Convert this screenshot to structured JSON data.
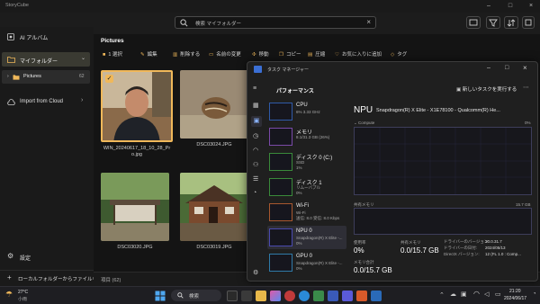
{
  "app": {
    "title": "StoryCube",
    "search_placeholder": "検索 マイフォルダー"
  },
  "sidebar": {
    "ai_album": "AI アルバム",
    "my_folder": "マイフォルダー",
    "pictures": "Pictures",
    "pictures_count": "62",
    "import_cloud": "Import from Cloud",
    "settings": "設定",
    "add_local": "ローカルフォルダーからファイルを..."
  },
  "main": {
    "folder_title": "Pictures",
    "toolbar": {
      "selected": "1 選択",
      "edit": "編集",
      "delete": "削除する",
      "rename": "名前の変更",
      "move": "移動",
      "copy": "コピー",
      "compress": "圧縮",
      "favorite": "お気に入りに追加",
      "tag": "タグ"
    },
    "photos": [
      {
        "caption": "WIN_20240617_18_10_28_Pr o.jpg"
      },
      {
        "caption": "DSC03024.JPG"
      },
      {
        "caption": "DSC03020.JPG"
      },
      {
        "caption": "DSC03019.JPG"
      }
    ],
    "status": "項目 (62)"
  },
  "taskmanager": {
    "title": "タスク マネージャー",
    "page": "パフォーマンス",
    "new_task": "新しいタスクを実行する",
    "items": [
      {
        "name": "CPU",
        "line1": "6% 3.33 GHz",
        "line2": ""
      },
      {
        "name": "メモリ",
        "line1": "8.1/31.3 GB (26%)",
        "line2": ""
      },
      {
        "name": "ディスク 0 (C:)",
        "line1": "SSD",
        "line2": "1%"
      },
      {
        "name": "ディスク 1",
        "line1": "リムーバブル",
        "line2": "0%"
      },
      {
        "name": "Wi-Fi",
        "line1": "Wi-Fi",
        "line2": "送信: 8.0 受信: 8.0 Kbps"
      },
      {
        "name": "NPU 0",
        "line1": "Snapdragon(R) X Elite -...",
        "line2": "0%"
      },
      {
        "name": "GPU 0",
        "line1": "Snapdragon(R) X Elite -...",
        "line2": "0%"
      }
    ],
    "detail": {
      "title": "NPU",
      "model": "Snapdragon(R) X Elite - X1E78100 - Qualcomm(R) He...",
      "compute_label": "Compute",
      "compute_max": "0%",
      "shared_mem_label": "共有メモリ",
      "shared_mem_max": "15.7 GB",
      "usage_label": "使用率",
      "usage_value": "0%",
      "shared_label": "共有メモリ",
      "shared_value": "0.0/15.7 GB",
      "memory_total_label": "メモリ合計",
      "memory_total_value": "0.0/15.7 GB",
      "driver_version_label": "ドライバーのバージョン:",
      "driver_version": "30.0.31.7",
      "driver_date_label": "ドライバーの日付:",
      "driver_date": "2024/05/13",
      "directx_label": "DirectX バージョン:",
      "directx": "12 (FL 1.0 : Comp..."
    }
  },
  "taskbar": {
    "temp": "27°C",
    "weather": "小雨",
    "search": "検索",
    "time": "21:20",
    "date": "2024/06/17"
  },
  "colors": {
    "accent": "#f0b85a",
    "npu_selected": "#2e2e36"
  }
}
